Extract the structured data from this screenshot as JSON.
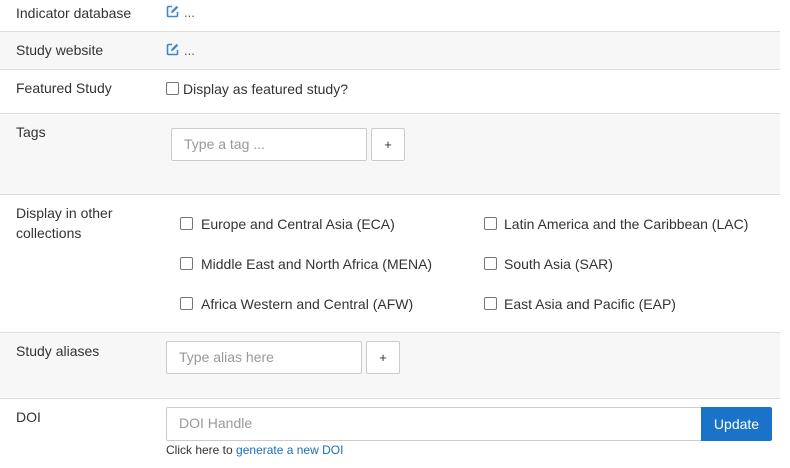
{
  "indicator_database": {
    "label": "Indicator database",
    "ellipsis": "..."
  },
  "study_website": {
    "label": "Study website",
    "ellipsis": "..."
  },
  "featured_study": {
    "label": "Featured Study",
    "checkbox_label": "Display as featured study?"
  },
  "tags": {
    "label": "Tags",
    "input_placeholder": "Type a tag ...",
    "add_label": "+"
  },
  "collections": {
    "label_line1": "Display in other",
    "label_line2": "collections",
    "items": [
      {
        "label": "Europe and Central Asia (ECA)"
      },
      {
        "label": "Latin America and the Caribbean (LAC)"
      },
      {
        "label": "Middle East and North Africa (MENA)"
      },
      {
        "label": "South Asia (SAR)"
      },
      {
        "label": "Africa Western and Central (AFW)"
      },
      {
        "label": "East Asia and Pacific (EAP)"
      }
    ]
  },
  "study_aliases": {
    "label": "Study aliases",
    "input_placeholder": "Type alias here",
    "add_label": "+"
  },
  "doi": {
    "label": "DOI",
    "input_placeholder": "DOI Handle",
    "update_label": "Update",
    "help_prefix": "Click here to",
    "help_link": "generate a new DOI"
  },
  "colors": {
    "accent": "#1a73c9",
    "link": "#1a6fb8",
    "edit_icon": "#3b86d1",
    "row_alt": "#f7f7f7"
  },
  "icons": {
    "edit": "edit-square-icon"
  }
}
